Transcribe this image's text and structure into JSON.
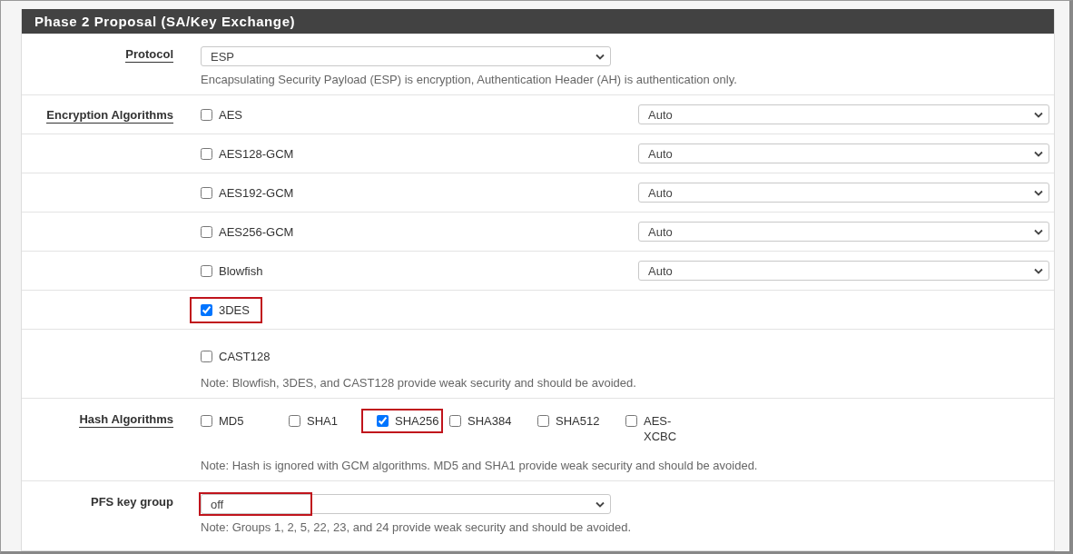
{
  "panel": {
    "title": "Phase 2 Proposal (SA/Key Exchange)"
  },
  "protocol": {
    "label": "Protocol",
    "underlined": true,
    "value": "ESP",
    "highlighted": false,
    "help": "Encapsulating Security Payload (ESP) is encryption, Authentication Header (AH) is authentication only."
  },
  "encryption": {
    "label": "Encryption Algorithms",
    "underlined": true,
    "algorithms": [
      {
        "name": "AES",
        "checked": false,
        "highlighted": false,
        "key_length": "Auto"
      },
      {
        "name": "AES128-GCM",
        "checked": false,
        "highlighted": false,
        "key_length": "Auto"
      },
      {
        "name": "AES192-GCM",
        "checked": false,
        "highlighted": false,
        "key_length": "Auto"
      },
      {
        "name": "AES256-GCM",
        "checked": false,
        "highlighted": false,
        "key_length": "Auto"
      },
      {
        "name": "Blowfish",
        "checked": false,
        "highlighted": false,
        "key_length": "Auto"
      },
      {
        "name": "3DES",
        "checked": true,
        "highlighted": true
      },
      {
        "name": "CAST128",
        "checked": false,
        "highlighted": false
      }
    ],
    "note": "Note: Blowfish, 3DES, and CAST128 provide weak security and should be avoided."
  },
  "hash": {
    "label": "Hash Algorithms",
    "underlined": true,
    "algorithms": [
      {
        "name": "MD5",
        "checked": false,
        "highlighted": false
      },
      {
        "name": "SHA1",
        "checked": false,
        "highlighted": false
      },
      {
        "name": "SHA256",
        "checked": true,
        "highlighted": true
      },
      {
        "name": "SHA384",
        "checked": false,
        "highlighted": false
      },
      {
        "name": "SHA512",
        "checked": false,
        "highlighted": false
      },
      {
        "name": "AES-XCBC",
        "checked": false,
        "highlighted": false
      }
    ],
    "note": "Note: Hash is ignored with GCM algorithms. MD5 and SHA1 provide weak security and should be avoided."
  },
  "pfs": {
    "label": "PFS key group",
    "underlined": false,
    "value": "off",
    "highlighted": true,
    "help": "Note: Groups 1, 2, 5, 22, 23, and 24 provide weak security and should be avoided."
  }
}
